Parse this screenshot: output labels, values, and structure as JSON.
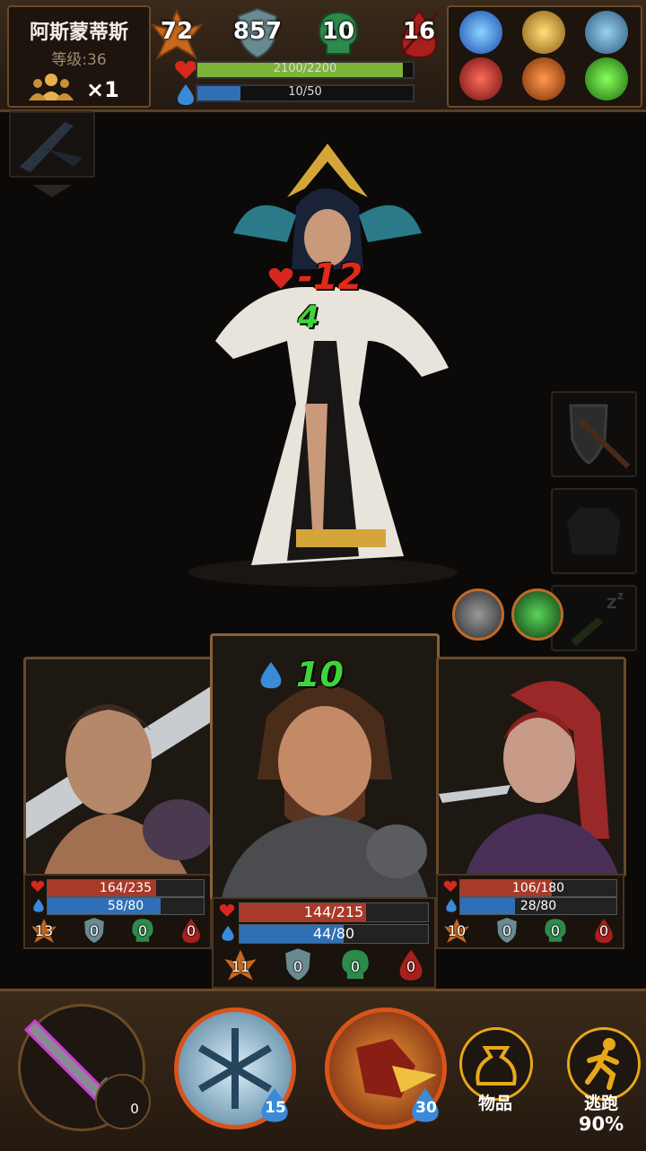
{
  "enemy": {
    "name": "阿斯蒙蒂斯",
    "level": "等级:36",
    "party_count": "×1",
    "attack": "72",
    "defense": "857",
    "poison": "10",
    "bleed": "16",
    "hp_text": "2100/2200",
    "hp_fraction": 0.955,
    "mp_text": "10/50",
    "mp_fraction": 0.2
  },
  "enemy_skills": [
    "vortex-skill-icon",
    "golden-slash-skill-icon",
    "ice-rock-skill-icon",
    "blood-strike-skill-icon",
    "flame-claw-skill-icon",
    "acid-claw-skill-icon"
  ],
  "combat_text": {
    "damage": "-12",
    "heal": "4",
    "mp_gain": "10"
  },
  "heroes": [
    {
      "hp_text": "164/235",
      "hp_fraction": 0.698,
      "mp_text": "58/80",
      "mp_fraction": 0.725,
      "attack": "13",
      "defense": "0",
      "poison": "0",
      "bleed": "0"
    },
    {
      "hp_text": "144/215",
      "hp_fraction": 0.67,
      "mp_text": "44/80",
      "mp_fraction": 0.55,
      "attack": "11",
      "defense": "0",
      "poison": "0",
      "bleed": "0"
    },
    {
      "hp_text": "106/180",
      "hp_fraction": 0.589,
      "mp_text": "28/80",
      "mp_fraction": 0.35,
      "attack": "10",
      "defense": "0",
      "poison": "0",
      "bleed": "0"
    }
  ],
  "actions": {
    "weapon_cost": "0",
    "frost_cost": "15",
    "fire_cost": "30",
    "items_label": "物品",
    "flee_label": "逃跑",
    "flee_chance": "90%"
  },
  "colors": {
    "hp": "#a83a2a",
    "mp": "#2f6fb5",
    "enemy_hp": "#7db43a",
    "damage": "#e02a1a",
    "heal": "#3fd43a",
    "frame": "#6b4a28"
  }
}
